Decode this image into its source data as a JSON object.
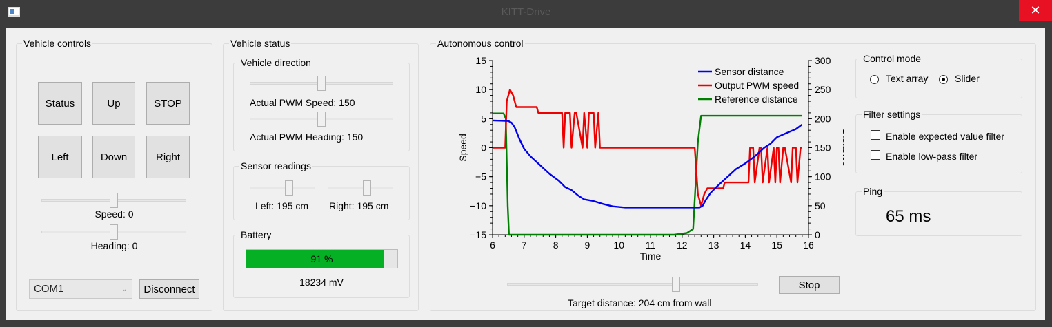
{
  "window": {
    "title": "KITT-Drive",
    "close_glyph": "✕",
    "icon": "app-window-icon"
  },
  "vehicle_controls": {
    "title": "Vehicle controls",
    "buttons": {
      "status": "Status",
      "up": "Up",
      "stop": "STOP",
      "left": "Left",
      "down": "Down",
      "right": "Right"
    },
    "speed_label": "Speed: 0",
    "heading_label": "Heading: 0",
    "speed_value": 0.5,
    "heading_value": 0.5,
    "port": "COM1",
    "disconnect": "Disconnect"
  },
  "vehicle_status": {
    "title": "Vehicle status",
    "direction": {
      "title": "Vehicle direction",
      "pwm_speed_label": "Actual PWM Speed: 150",
      "pwm_heading_label": "Actual PWM Heading: 150",
      "pwm_speed_value": 0.5,
      "pwm_heading_value": 0.5
    },
    "sensors": {
      "title": "Sensor readings",
      "left_label": "Left: 195 cm",
      "right_label": "Right: 195 cm",
      "left_value": 0.62,
      "right_value": 0.62
    },
    "battery": {
      "title": "Battery",
      "percent": 91,
      "percent_label": "91 %",
      "voltage": "18234 mV"
    }
  },
  "autonomous": {
    "title": "Autonomous control",
    "stop": "Stop",
    "target_label": "Target distance: 204 cm from wall",
    "target_value": 0.68
  },
  "control_mode": {
    "title": "Control mode",
    "option_text": "Text array",
    "option_slider": "Slider",
    "selected": "slider"
  },
  "filter": {
    "title": "Filter settings",
    "expected": "Enable expected value filter",
    "lowpass": "Enable low-pass filter"
  },
  "ping": {
    "title": "Ping",
    "value": "65 ms"
  },
  "chart_data": {
    "type": "line",
    "xlabel": "Time",
    "ylabel": "Speed",
    "y2label": "Distance",
    "xlim": [
      6,
      16
    ],
    "ylim": [
      -15,
      15
    ],
    "y2lim": [
      0,
      300
    ],
    "xticks": [
      6,
      7,
      8,
      9,
      10,
      11,
      12,
      13,
      14,
      15,
      16
    ],
    "yticks": [
      15,
      10,
      5,
      0,
      -5,
      -10,
      -15
    ],
    "y2ticks": [
      300,
      250,
      200,
      150,
      100,
      50,
      0
    ],
    "legend_position": "top-right",
    "series": [
      {
        "name": "Sensor distance",
        "axis": "right",
        "color": "#0000ee",
        "x": [
          6,
          6.5,
          6.6,
          6.7,
          6.85,
          7,
          7.2,
          7.5,
          7.8,
          8.1,
          8.3,
          8.5,
          8.7,
          8.9,
          9.2,
          9.5,
          9.8,
          10.2,
          10.6,
          11,
          11.4,
          11.8,
          12.1,
          12.3,
          12.45,
          12.55,
          12.65,
          12.75,
          12.9,
          13.1,
          13.4,
          13.7,
          14,
          14.3,
          14.6,
          14.8,
          15,
          15.3,
          15.6,
          15.8
        ],
        "y": [
          197,
          196,
          193,
          185,
          165,
          148,
          135,
          120,
          105,
          93,
          82,
          77,
          68,
          61,
          58,
          53,
          49,
          47,
          47,
          47,
          47,
          47,
          47,
          47,
          47,
          47,
          50,
          60,
          72,
          83,
          98,
          113,
          123,
          135,
          150,
          157,
          168,
          175,
          182,
          190
        ]
      },
      {
        "name": "Output PWM speed",
        "axis": "left",
        "color": "#ee0000",
        "x": [
          6,
          6.4,
          6.45,
          6.55,
          6.65,
          6.75,
          6.9,
          7.4,
          7.45,
          8.2,
          8.25,
          8.3,
          8.45,
          8.5,
          8.6,
          8.65,
          8.85,
          8.9,
          9.0,
          9.05,
          9.2,
          9.25,
          9.35,
          9.4,
          12.4,
          12.5,
          12.6,
          12.7,
          12.8,
          13.3,
          13.35,
          14.1,
          14.15,
          14.25,
          14.3,
          14.45,
          14.5,
          14.55,
          14.7,
          14.75,
          14.9,
          14.95,
          15.0,
          15.05,
          15.1,
          15.2,
          15.25,
          15.45,
          15.5,
          15.6,
          15.65,
          15.75,
          15.8
        ],
        "y": [
          0,
          0,
          8,
          10,
          9,
          7,
          7,
          7,
          6,
          6,
          0,
          6,
          6,
          0,
          6,
          6,
          0,
          6,
          0,
          6,
          6,
          0,
          6,
          0,
          0,
          -8,
          -10,
          -8,
          -7,
          -7,
          -6,
          -6,
          0,
          0,
          -6,
          0,
          0,
          -6,
          0,
          -6,
          0,
          -6,
          0,
          0,
          -6,
          0,
          0,
          -6,
          0,
          0,
          -6,
          0,
          0
        ]
      },
      {
        "name": "Reference distance",
        "axis": "right",
        "color": "#008000",
        "x": [
          6,
          6.35,
          6.42,
          6.48,
          6.52,
          11.75,
          12.15,
          12.35,
          12.5,
          12.6,
          12.7,
          15.8
        ],
        "y": [
          209,
          209,
          200,
          50,
          0,
          0,
          3,
          10,
          160,
          205,
          205,
          205
        ]
      }
    ]
  }
}
